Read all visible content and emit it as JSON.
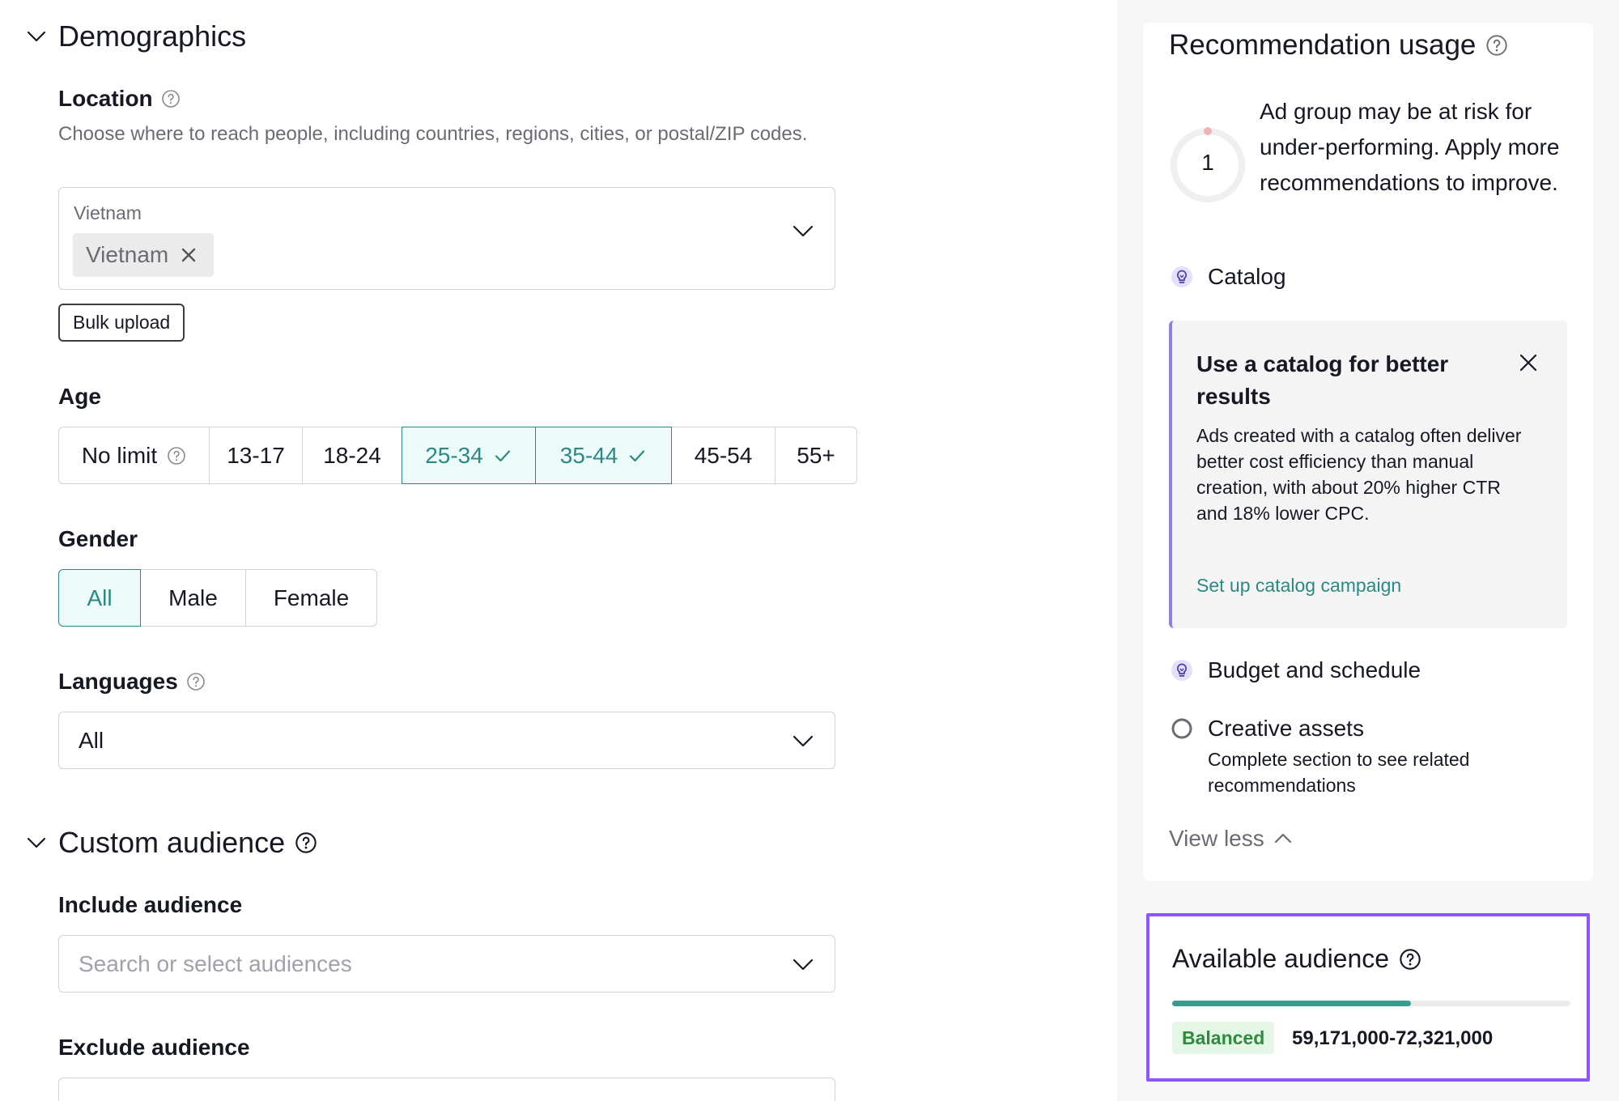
{
  "demographics": {
    "title": "Demographics",
    "location": {
      "label": "Location",
      "description": "Choose where to reach people, including countries, regions, cities, or postal/ZIP codes.",
      "field_label": "Vietnam",
      "chips": [
        "Vietnam"
      ],
      "bulk_upload_label": "Bulk upload"
    },
    "age": {
      "label": "Age",
      "options": [
        {
          "label": "No limit",
          "selected": false
        },
        {
          "label": "13-17",
          "selected": false
        },
        {
          "label": "18-24",
          "selected": false
        },
        {
          "label": "25-34",
          "selected": true
        },
        {
          "label": "35-44",
          "selected": true
        },
        {
          "label": "45-54",
          "selected": false
        },
        {
          "label": "55+",
          "selected": false
        }
      ]
    },
    "gender": {
      "label": "Gender",
      "options": [
        {
          "label": "All",
          "selected": true
        },
        {
          "label": "Male",
          "selected": false
        },
        {
          "label": "Female",
          "selected": false
        }
      ]
    },
    "languages": {
      "label": "Languages",
      "value": "All"
    }
  },
  "custom_audience": {
    "title": "Custom audience",
    "include_label": "Include audience",
    "include_placeholder": "Search or select audiences",
    "exclude_label": "Exclude audience"
  },
  "recommendation": {
    "title": "Recommendation usage",
    "count": "1",
    "risk_text": "Ad group may be at risk for under-performing. Apply more recommendations to improve.",
    "items": {
      "catalog": "Catalog",
      "budget": "Budget and schedule",
      "creative": "Creative assets",
      "creative_sub": "Complete section to see related recommendations"
    },
    "tip": {
      "title": "Use a catalog for better results",
      "body": "Ads created with a catalog often deliver better cost efficiency than manual creation, with about 20% higher CTR and 18% lower CPC.",
      "link": "Set up catalog campaign"
    },
    "view_less": "View less"
  },
  "available_audience": {
    "title": "Available audience",
    "fill_fraction": 0.6,
    "status": "Balanced",
    "range": "59,171,000-72,321,000"
  },
  "colors": {
    "accent_teal": "#2a8a83",
    "highlight_purple": "#8c55ff",
    "tip_border": "#8b7ef0",
    "badge_green": "#2f8a3c"
  }
}
